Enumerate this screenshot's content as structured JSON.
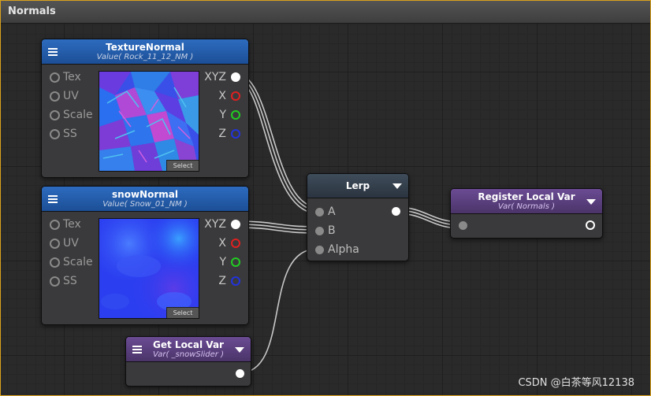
{
  "window": {
    "title": "Normals"
  },
  "nodes": {
    "texture_normal": {
      "title": "TextureNormal",
      "subtitle": "Value( Rock_11_12_NM )",
      "inputs": [
        "Tex",
        "UV",
        "Scale",
        "SS"
      ],
      "outputs": [
        "XYZ",
        "X",
        "Y",
        "Z"
      ],
      "select_label": "Select"
    },
    "snow_normal": {
      "title": "snowNormal",
      "subtitle": "Value( Snow_01_NM )",
      "inputs": [
        "Tex",
        "UV",
        "Scale",
        "SS"
      ],
      "outputs": [
        "XYZ",
        "X",
        "Y",
        "Z"
      ],
      "select_label": "Select"
    },
    "lerp": {
      "title": "Lerp",
      "inputs": [
        "A",
        "B",
        "Alpha"
      ]
    },
    "register_local_var": {
      "title": "Register Local Var",
      "subtitle": "Var( Normals )"
    },
    "get_local_var": {
      "title": "Get Local Var",
      "subtitle": "Var( _snowSlider )"
    }
  },
  "port_colors": {
    "XYZ": "#ffffff",
    "X": "#e02020",
    "Y": "#22cc22",
    "Z": "#2233dd"
  },
  "watermark": "CSDN @白茶等风12138"
}
